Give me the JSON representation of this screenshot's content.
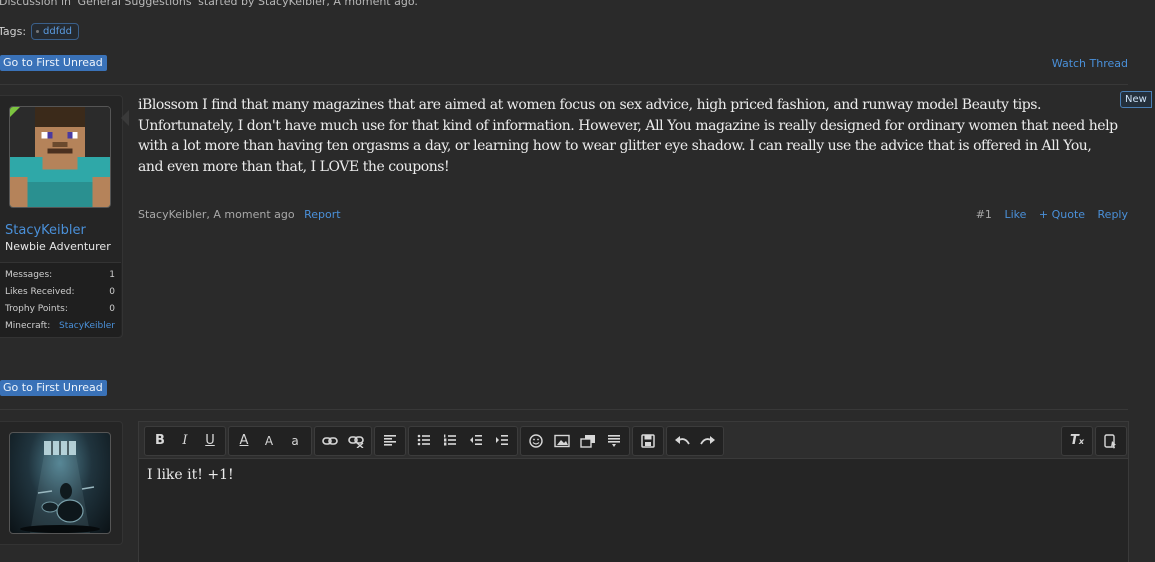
{
  "thread": {
    "byline": "Discussion in 'General Suggestions' started by StacyKeibler, A moment ago.",
    "tags_label": "Tags:",
    "tag": "ddfdd",
    "go_first_unread": "Go to First Unread",
    "watch_thread": "Watch Thread"
  },
  "post": {
    "author": "StacyKeibler",
    "user_title": "Newbie Adventurer",
    "stats": [
      {
        "label": "Messages:",
        "value": "1"
      },
      {
        "label": "Likes Received:",
        "value": "0"
      },
      {
        "label": "Trophy Points:",
        "value": "0"
      },
      {
        "label": "Minecraft:",
        "value": "StacyKeibler"
      }
    ],
    "new_badge": "New",
    "body": "iBlossom I find that many magazines that are aimed at women focus on sex advice, high priced fashion, and runway model Beauty tips. Unfortunately, I don't have much use for that kind of information. However, All You magazine is really designed for ordinary women that need help with a lot more than having ten orgasms a day, or learning how to wear glitter eye shadow. I can really use the advice that is offered in All You, and even more than that, I LOVE the coupons!",
    "meta_author": "StacyKeibler",
    "meta_time": ", A moment ago",
    "report": "Report",
    "number": "#1",
    "like": "Like",
    "quote": "+ Quote",
    "reply": "Reply"
  },
  "reply_box": {
    "text": "I like it! +1!",
    "toolbar": {
      "bold": "B",
      "italic": "I",
      "underline": "U",
      "font_color": "A",
      "font_size": "A",
      "font_family": "a",
      "remove_format": "T"
    }
  }
}
